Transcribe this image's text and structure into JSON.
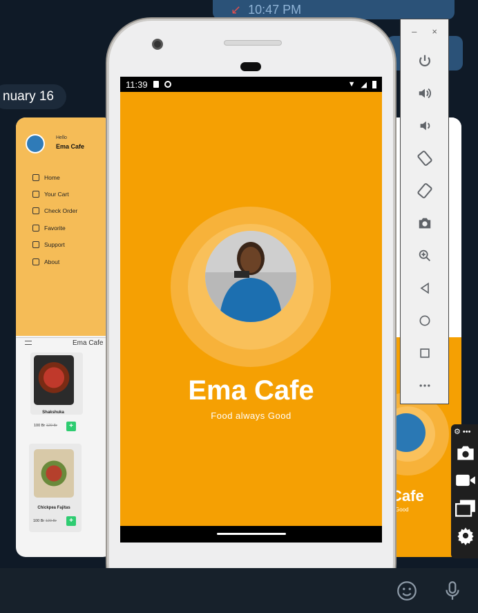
{
  "background": {
    "chat_time": "10:47 PM",
    "date_label": "nuary 16",
    "emoji_icon": "smiley-icon",
    "mic_icon": "microphone-icon"
  },
  "left_card": {
    "hello": "Hello",
    "name": "Ema Cafe",
    "menu_items": [
      "Home",
      "Your Cart",
      "Check Order",
      "Favorite",
      "Support",
      "About"
    ],
    "title": "Ema Cafe",
    "foods": [
      {
        "name": "Shakshuka",
        "price": "100 Br",
        "old_price": "120 Br",
        "add": "+"
      },
      {
        "name": "Chickpea Fajitas",
        "price": "100 Br",
        "old_price": "120 Br",
        "add": "+"
      }
    ]
  },
  "right_card": {
    "title": "Cafe",
    "subtitle": "Good"
  },
  "phone": {
    "status_time": "11:39",
    "app_title": "Ema Cafe",
    "app_subtitle": "Food always Good",
    "colors": {
      "primary": "#f5a003",
      "ring_outer": "#f7b23a",
      "ring_inner": "#f9c05a"
    }
  },
  "emulator": {
    "minimize": "–",
    "close": "×",
    "buttons": [
      "power-icon",
      "volume-up-icon",
      "volume-down-icon",
      "rotate-left-icon",
      "rotate-right-icon",
      "screenshot-icon",
      "zoom-icon",
      "back-icon",
      "home-icon",
      "overview-icon",
      "more-icon"
    ]
  }
}
